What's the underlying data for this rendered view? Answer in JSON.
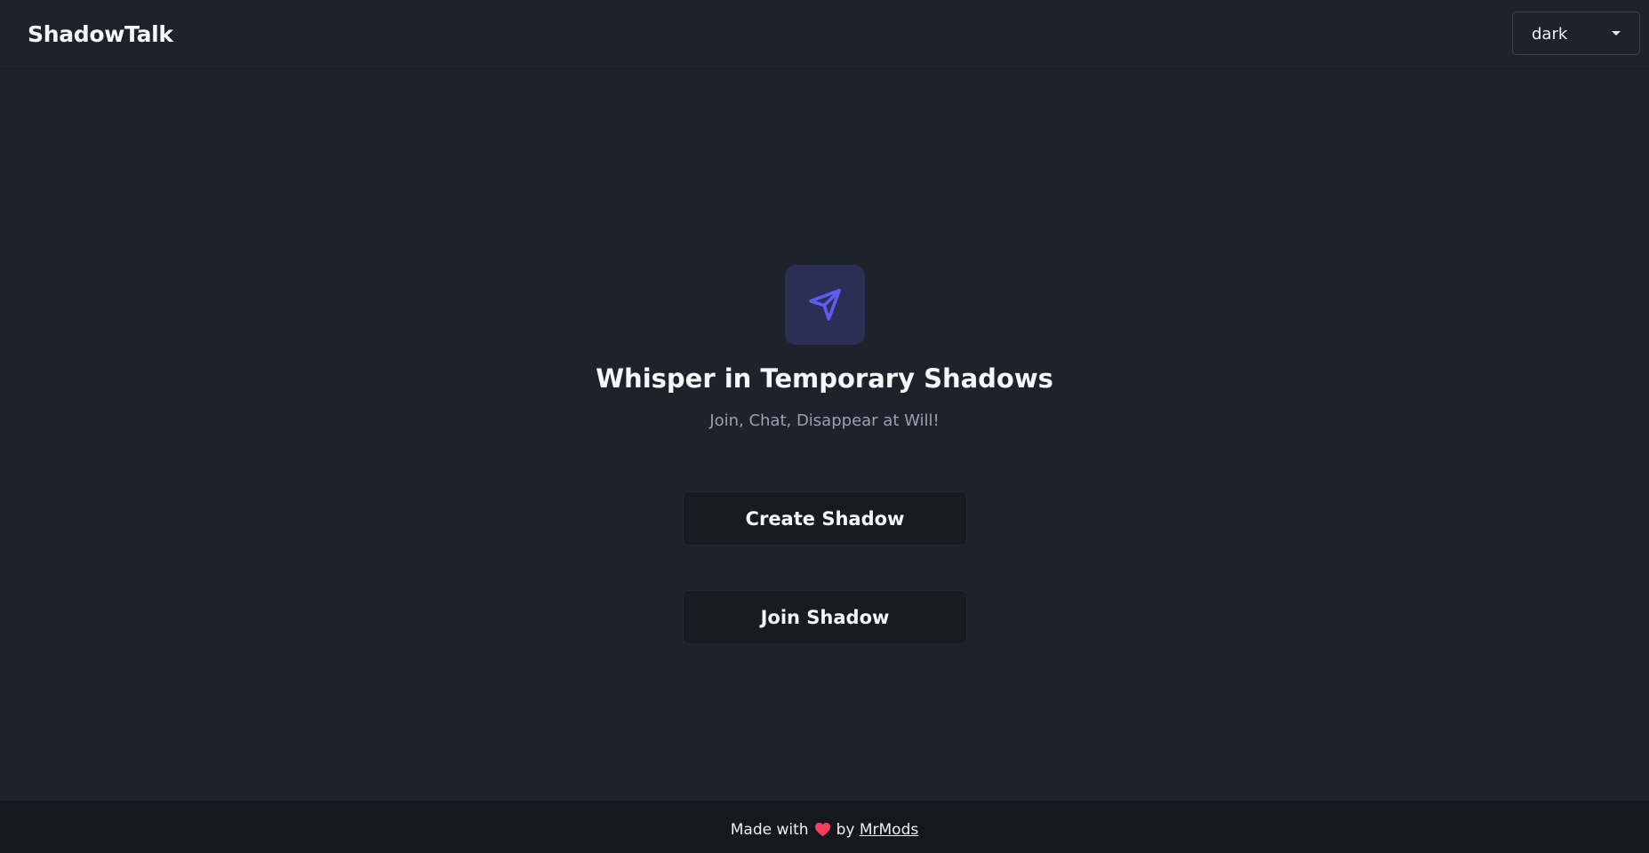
{
  "header": {
    "brand": "ShadowTalk",
    "theme_select": {
      "value": "dark",
      "icon": "chevron-down-icon"
    }
  },
  "hero": {
    "logo_icon": "paper-plane-icon",
    "headline": "Whisper in Temporary Shadows",
    "tagline": "Join, Chat, Disappear at Will!"
  },
  "actions": {
    "create_label": "Create Shadow",
    "join_label": "Join Shadow"
  },
  "footer": {
    "made_with": "Made with",
    "heart_icon": "heart-icon",
    "by": "by",
    "author": "MrMods"
  },
  "colors": {
    "background": "#1d222b",
    "accent": "#5b5cf0",
    "heart": "#f43f5e",
    "footer": "#16181d"
  }
}
